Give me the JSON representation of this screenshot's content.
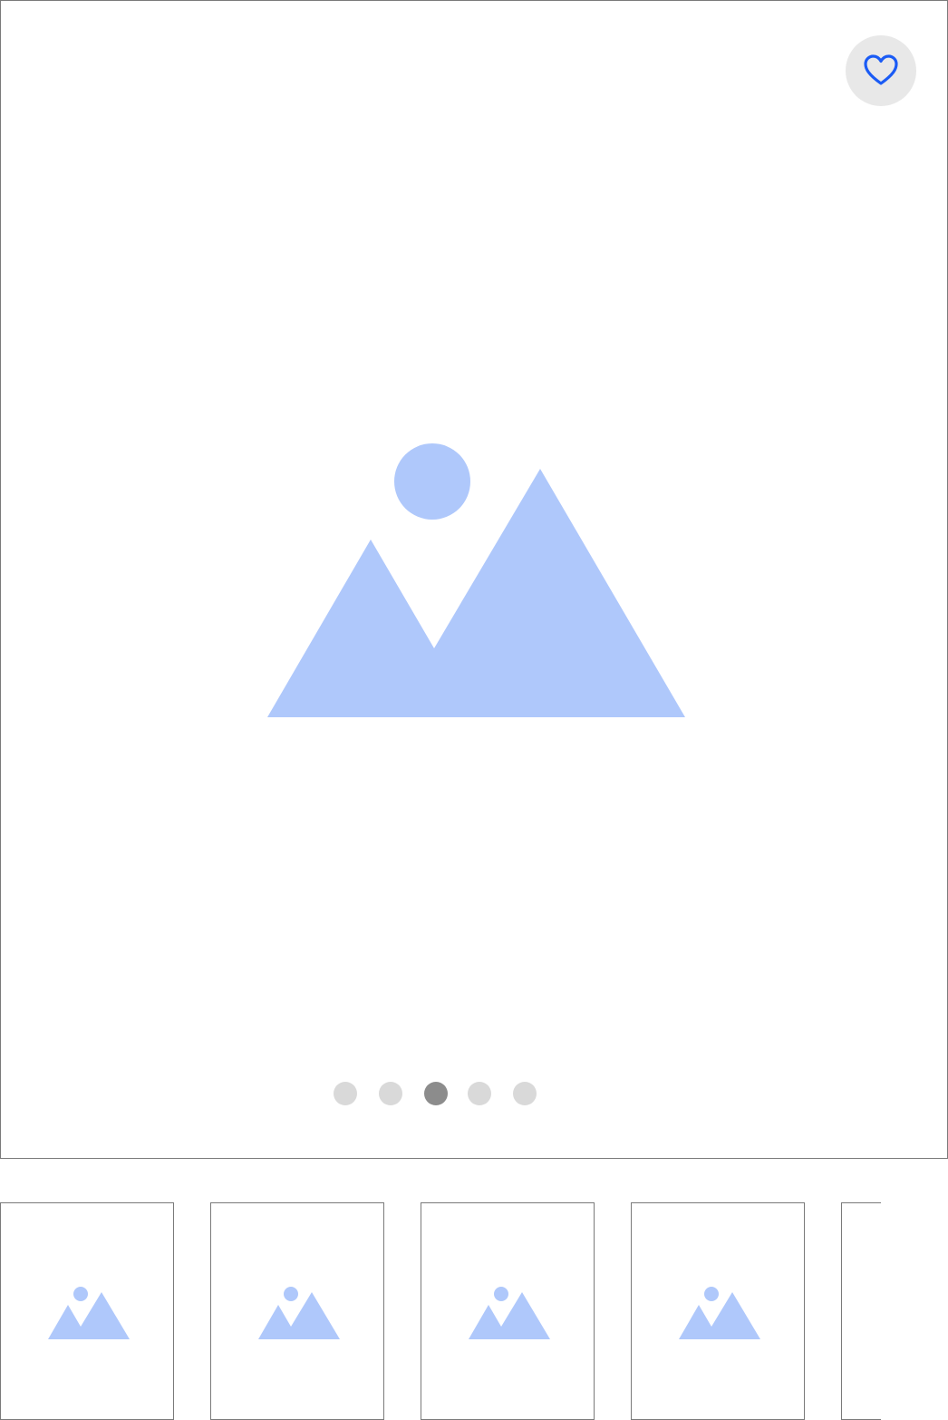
{
  "carousel": {
    "active_index": 2,
    "total_slides": 5,
    "favorite_icon": "heart-outline-icon",
    "placeholder_icon": "image-placeholder-icon"
  },
  "thumbnails": {
    "count_visible": 5
  },
  "colors": {
    "placeholder": "#afc8fb",
    "favorite": "#1a5bf5",
    "dot_active": "#8c8c8c",
    "dot_inactive": "#d9d9d9",
    "border": "#7a7a7a"
  }
}
